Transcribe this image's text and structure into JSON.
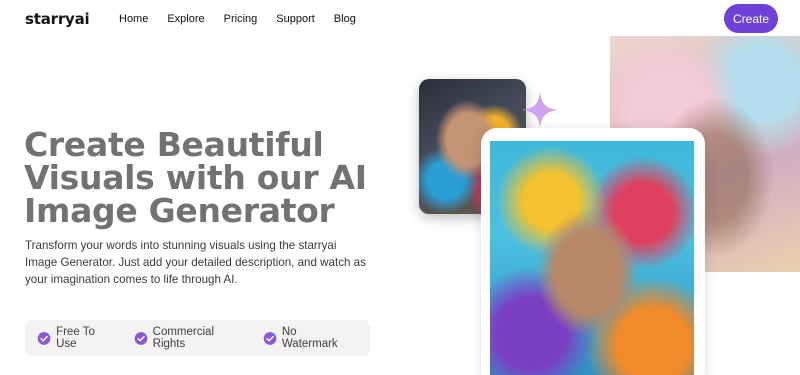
{
  "brand": {
    "logo": "starryai"
  },
  "nav": {
    "items": [
      {
        "label": "Home"
      },
      {
        "label": "Explore"
      },
      {
        "label": "Pricing"
      },
      {
        "label": "Support"
      },
      {
        "label": "Blog"
      }
    ],
    "create_label": "Create"
  },
  "hero": {
    "title": "Create Beautiful Visuals with our AI Image Generator",
    "subtitle": "Transform your words into stunning visuals using the starryai Image Generator. Just add your detailed description, and watch as your imagination comes to life through AI."
  },
  "features": [
    {
      "label": "Free To Use",
      "icon": "check-badge-icon"
    },
    {
      "label": "Commercial Rights",
      "icon": "check-badge-icon"
    },
    {
      "label": "No Watermark",
      "icon": "check-badge-icon"
    }
  ],
  "colors": {
    "accent": "#6e42d8",
    "badge": "#8a5ad6",
    "title_gray": "#727272",
    "pill_bg": "#f3f3f3"
  },
  "images": [
    {
      "name": "woman-portrait-image"
    },
    {
      "name": "man-portrait-image"
    },
    {
      "name": "bearded-man-background-image"
    }
  ]
}
